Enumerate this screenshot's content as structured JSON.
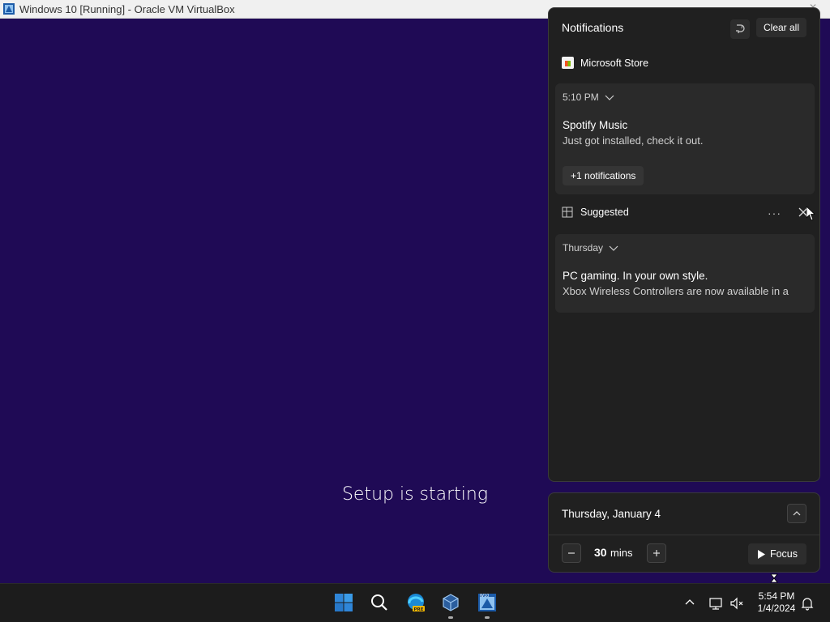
{
  "window": {
    "title": "Windows 10 [Running] - Oracle VM VirtualBox"
  },
  "guest": {
    "setup_text": "Setup is starting"
  },
  "notifications": {
    "header": "Notifications",
    "clear_all_label": "Clear all",
    "app_group": "Microsoft Store",
    "cards": [
      {
        "time": "5:10 PM",
        "title": "Spotify Music",
        "body": "Just got installed, check it out.",
        "more_label": "+1 notifications"
      },
      {
        "time": "Thursday",
        "title": "PC gaming. In your own style.",
        "body": "Xbox Wireless Controllers are now available in a"
      }
    ],
    "suggested_label": "Suggested",
    "suggested_more": "···"
  },
  "calendar": {
    "date_label": "Thursday, January 4",
    "focus_minutes": "30",
    "focus_unit": "mins",
    "focus_button_label": "Focus"
  },
  "taskbar": {
    "icons": [
      "windows-start-icon",
      "search-icon",
      "edge-pre-icon",
      "virtualbox-icon",
      "virtualbox-manager-icon"
    ],
    "time": "5:54 PM",
    "date": "1/4/2024"
  },
  "colors": {
    "guest_background": "#1f0a55",
    "panel_background": "#202020",
    "card_background": "#2a2a2a",
    "taskbar_background": "#1c1c1c",
    "start_blue": "#2f86d8"
  }
}
